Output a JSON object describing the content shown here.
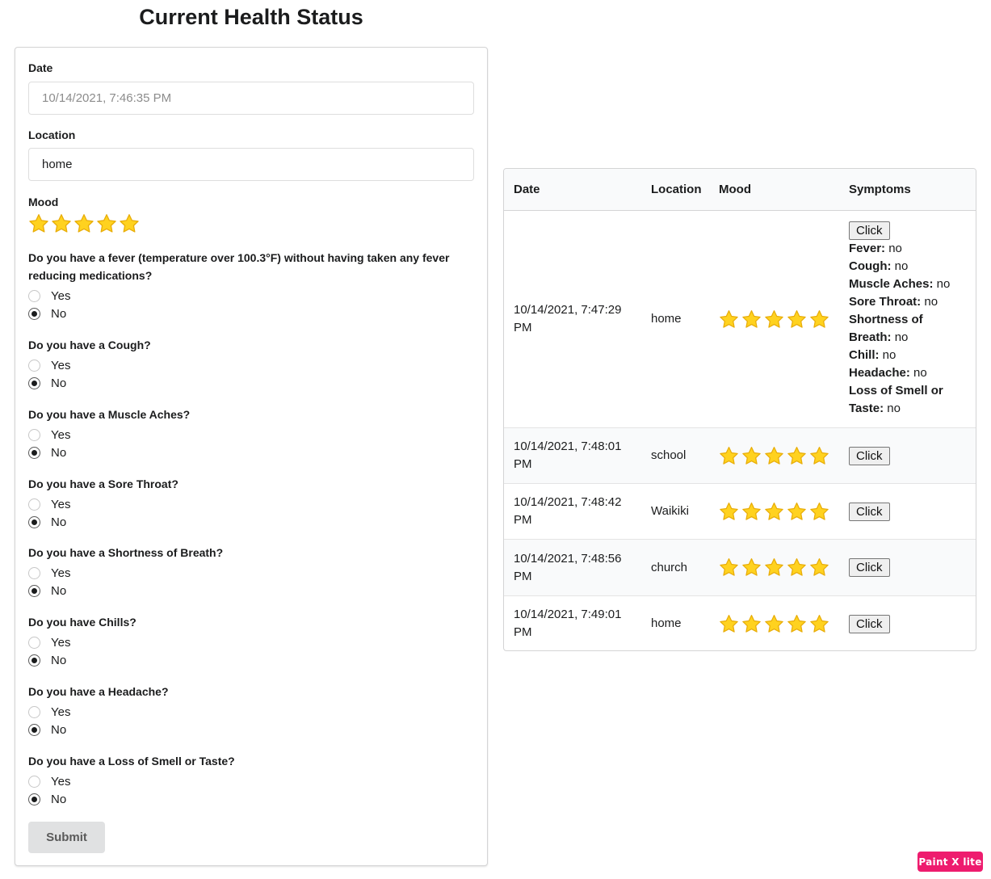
{
  "page_title": "Current Health Status",
  "colors": {
    "star_fill": "#ffd21f",
    "star_stroke": "#e8ad0a",
    "badge": "#ee1c6e"
  },
  "form": {
    "date_label": "Date",
    "date_value": "10/14/2021, 7:46:35 PM",
    "location_label": "Location",
    "location_value": "home",
    "mood_label": "Mood",
    "mood_stars": 5,
    "questions": [
      {
        "text": "Do you have a fever (temperature over 100.3°F) without having taken any fever reducing medications?",
        "yes": "Yes",
        "no": "No",
        "selected": "No"
      },
      {
        "text": "Do you have a Cough?",
        "yes": "Yes",
        "no": "No",
        "selected": "No"
      },
      {
        "text": "Do you have a Muscle Aches?",
        "yes": "Yes",
        "no": "No",
        "selected": "No"
      },
      {
        "text": "Do you have a Sore Throat?",
        "yes": "Yes",
        "no": "No",
        "selected": "No"
      },
      {
        "text": "Do you have a Shortness of Breath?",
        "yes": "Yes",
        "no": "No",
        "selected": "No"
      },
      {
        "text": "Do you have Chills?",
        "yes": "Yes",
        "no": "No",
        "selected": "No"
      },
      {
        "text": "Do you have a Headache?",
        "yes": "Yes",
        "no": "No",
        "selected": "No"
      },
      {
        "text": "Do you have a Loss of Smell or Taste?",
        "yes": "Yes",
        "no": "No",
        "selected": "No"
      }
    ],
    "submit_label": "Submit"
  },
  "table": {
    "headers": [
      "Date",
      "Location",
      "Mood",
      "Symptoms"
    ],
    "button_label": "Click",
    "rows": [
      {
        "date": "10/14/2021, 7:47:29 PM",
        "location": "home",
        "mood": 5,
        "symptoms": [
          {
            "label": "Fever:",
            "value": "no"
          },
          {
            "label": "Cough:",
            "value": "no"
          },
          {
            "label": "Muscle Aches:",
            "value": "no"
          },
          {
            "label": "Sore Throat:",
            "value": "no"
          },
          {
            "label": "Shortness of Breath:",
            "value": "no"
          },
          {
            "label": "Chill:",
            "value": "no"
          },
          {
            "label": "Headache:",
            "value": "no"
          },
          {
            "label": "Loss of Smell or Taste:",
            "value": "no"
          }
        ]
      },
      {
        "date": "10/14/2021, 7:48:01 PM",
        "location": "school",
        "mood": 5
      },
      {
        "date": "10/14/2021, 7:48:42 PM",
        "location": "Waikiki",
        "mood": 5
      },
      {
        "date": "10/14/2021, 7:48:56 PM",
        "location": "church",
        "mood": 5
      },
      {
        "date": "10/14/2021, 7:49:01 PM",
        "location": "home",
        "mood": 5
      }
    ]
  },
  "badge_text": "Paint X lite"
}
